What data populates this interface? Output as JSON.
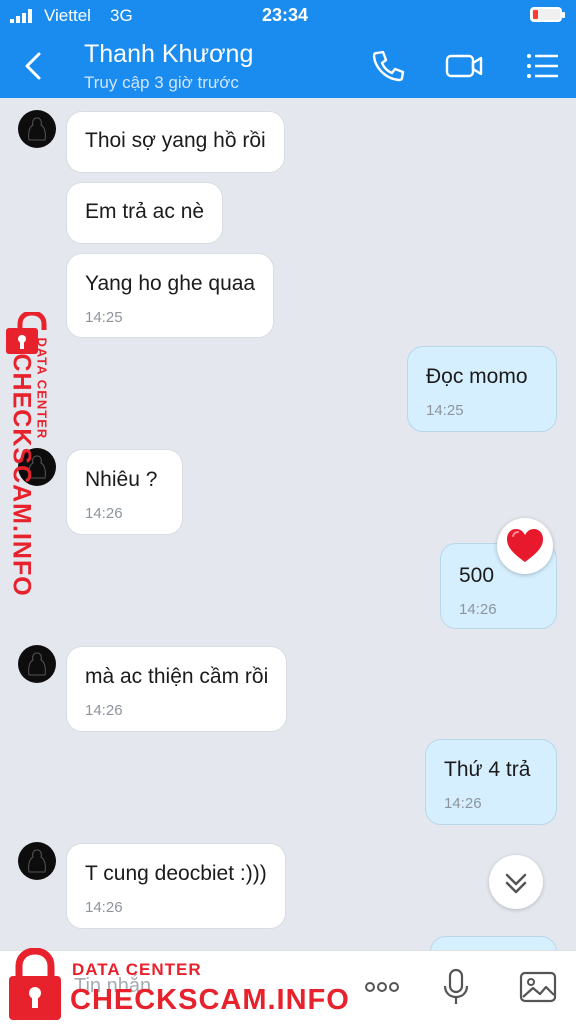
{
  "status_bar": {
    "carrier": "Viettel",
    "network": "3G",
    "time": "23:34"
  },
  "header": {
    "contact_name": "Thanh Khương",
    "last_seen": "Truy cập 3 giờ trước",
    "icons": [
      "back-icon",
      "phone-icon",
      "video-call-icon",
      "menu-list-icon"
    ]
  },
  "messages": [
    {
      "direction": "in",
      "text": "Thoi sợ yang hồ rồi",
      "time": ""
    },
    {
      "direction": "in",
      "text": "Em trả ac nè",
      "time": ""
    },
    {
      "direction": "in",
      "text": "Yang ho ghe quaa",
      "time": "14:25"
    },
    {
      "direction": "out",
      "text": "Đọc momo",
      "time": "14:25"
    },
    {
      "direction": "in",
      "text": "Nhiêu ?",
      "time": "14:26"
    },
    {
      "direction": "out",
      "text": "500",
      "time": "14:26",
      "reaction": "heart"
    },
    {
      "direction": "in",
      "text": "mà ac thiện cầm rồi",
      "time": "14:26"
    },
    {
      "direction": "out",
      "text": "Thứ 4 trả",
      "time": "14:26"
    },
    {
      "direction": "in",
      "text": "T cung deocbiet :)))",
      "time": "14:26"
    }
  ],
  "composer": {
    "placeholder": "Tin nhắn",
    "icons": [
      "more-icon",
      "microphone-icon",
      "image-icon"
    ]
  },
  "watermark": {
    "line1": "DATA CENTER",
    "line2": "CHECKSCAM.INFO"
  },
  "colors": {
    "header": "#1a8cf0",
    "chat_background": "#e4e8ee",
    "incoming_bubble": "#ffffff",
    "outgoing_bubble": "#d5efff",
    "watermark": "#e8222c",
    "heart": "#e8192c"
  }
}
